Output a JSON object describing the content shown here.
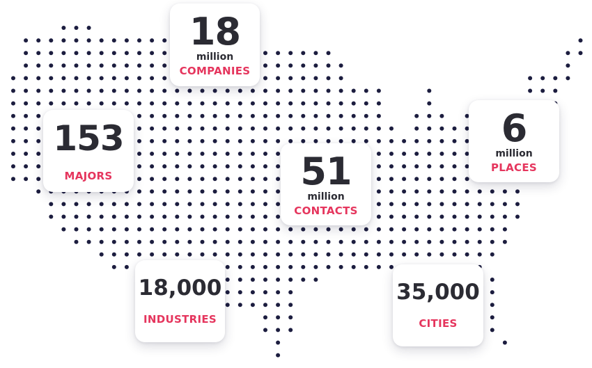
{
  "stats": {
    "companies": {
      "number": "18",
      "unit": "million",
      "label": "COMPANIES"
    },
    "majors": {
      "number": "153",
      "label": "MAJORS"
    },
    "contacts": {
      "number": "51",
      "unit": "million",
      "label": "CONTACTS"
    },
    "places": {
      "number": "6",
      "unit": "million",
      "label": "PLACES"
    },
    "industries": {
      "number": "18,000",
      "label": "INDUSTRIES"
    },
    "cities": {
      "number": "35,000",
      "label": "CITIES"
    }
  },
  "colors": {
    "dot": "#1c1d3f",
    "number_text": "#2b2b33",
    "label_accent": "#e5355d",
    "card_background": "#ffffff"
  }
}
